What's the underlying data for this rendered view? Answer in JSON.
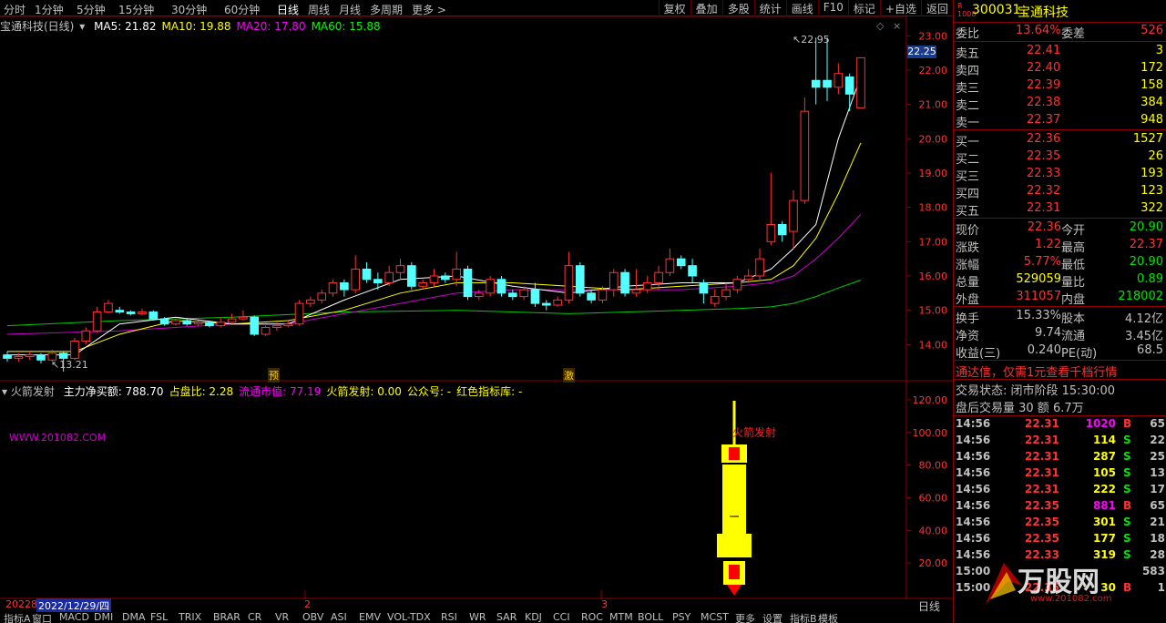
{
  "toolbar": {
    "periods": [
      "分时",
      "1分钟",
      "5分钟",
      "15分钟",
      "30分钟",
      "60分钟",
      "日线",
      "周线",
      "月线",
      "多周期",
      "更多 >"
    ],
    "active": "日线",
    "right_buttons": [
      "复权",
      "叠加",
      "多股",
      "统计",
      "画线",
      "F10",
      "标记",
      "+自选",
      "返回"
    ]
  },
  "main": {
    "title": "宝通科技(日线)",
    "ma": [
      {
        "label": "MA5: 21.82",
        "color": "#ffffff"
      },
      {
        "label": "MA10: 19.88",
        "color": "#ffff00"
      },
      {
        "label": "MA20: 17.80",
        "color": "#ff00ff"
      },
      {
        "label": "MA60: 15.88",
        "color": "#00ff00"
      }
    ],
    "price_label": "22.25",
    "high_label": "22.95",
    "low_label": "13.21",
    "marker1": "预",
    "marker2": "激",
    "y_ticks": [
      "23.00",
      "22.00",
      "21.00",
      "20.00",
      "19.00",
      "18.00",
      "17.00",
      "16.00",
      "15.00",
      "14.00"
    ],
    "collapse_icon": "diamond-icon"
  },
  "sub": {
    "title": "火箭发射",
    "items": [
      {
        "label": "主力净买额: 788.70",
        "color": "#ffffff"
      },
      {
        "label": "占盘比: 2.28",
        "color": "#ffff00"
      },
      {
        "label": "流通市值: 77.19",
        "color": "#ff00ff"
      },
      {
        "label": "火箭发射: 0.00",
        "color": "#ffff00"
      },
      {
        "label": "公众号: -",
        "color": "#ffff00"
      },
      {
        "label": "红色指标库: -",
        "color": "#ffff00"
      }
    ],
    "watermark": "WWW.201082.COM",
    "rocket_label": "火箭发射",
    "y_ticks": [
      "120.00",
      "100.00",
      "80.00",
      "60.00",
      "40.00",
      "20.00"
    ]
  },
  "dates": {
    "d1": "20228",
    "d2": "2022/12/29/四",
    "d3": "2",
    "d4": "3",
    "corner": "日线"
  },
  "bottom_tabs": [
    "指标A",
    "窗口",
    "MACD",
    "DMI",
    "DMA",
    "FSL",
    "TRIX",
    "BRAR",
    "CR",
    "VR",
    "OBV",
    "ASI",
    "EMV",
    "VOL-TDX",
    "RSI",
    "WR",
    "SAR",
    "KDJ",
    "CCI",
    "ROC",
    "MTM",
    "BOLL",
    "PSY",
    "MCST",
    "更多",
    "设置",
    "指标B",
    "模板"
  ],
  "quote": {
    "code": "300031",
    "name": "宝通科技",
    "weibi_label": "委比",
    "weibi": "13.64%",
    "weicha_label": "委差",
    "weicha": "526",
    "asks": [
      {
        "l": "卖五",
        "p": "22.41",
        "v": "3"
      },
      {
        "l": "卖四",
        "p": "22.40",
        "v": "172"
      },
      {
        "l": "卖三",
        "p": "22.39",
        "v": "158"
      },
      {
        "l": "卖二",
        "p": "22.38",
        "v": "384"
      },
      {
        "l": "卖一",
        "p": "22.37",
        "v": "948"
      }
    ],
    "bids": [
      {
        "l": "买一",
        "p": "22.36",
        "v": "1527"
      },
      {
        "l": "买二",
        "p": "22.35",
        "v": "26"
      },
      {
        "l": "买三",
        "p": "22.33",
        "v": "193"
      },
      {
        "l": "买四",
        "p": "22.32",
        "v": "123"
      },
      {
        "l": "买五",
        "p": "22.31",
        "v": "322"
      }
    ],
    "stats": [
      {
        "l1": "现价",
        "v1": "22.36",
        "c1": "#ff3232",
        "l2": "今开",
        "v2": "20.90",
        "c2": "#00e600"
      },
      {
        "l1": "涨跌",
        "v1": "1.22",
        "c1": "#ff3232",
        "l2": "最高",
        "v2": "22.37",
        "c2": "#ff3232"
      },
      {
        "l1": "涨幅",
        "v1": "5.77%",
        "c1": "#ff3232",
        "l2": "最低",
        "v2": "20.90",
        "c2": "#00e600"
      },
      {
        "l1": "总量",
        "v1": "529059",
        "c1": "#ffff00",
        "l2": "量比",
        "v2": "0.89",
        "c2": "#00e600"
      },
      {
        "l1": "外盘",
        "v1": "311057",
        "c1": "#ff3232",
        "l2": "内盘",
        "v2": "218002",
        "c2": "#00e600"
      }
    ],
    "stats2": [
      {
        "l1": "换手",
        "v1": "15.33%",
        "l2": "股本",
        "v2": "4.12亿"
      },
      {
        "l1": "净资",
        "v1": "9.74",
        "l2": "流通",
        "v2": "3.45亿"
      },
      {
        "l1": "收益(三)",
        "v1": "0.240",
        "l2": "PE(动)",
        "v2": "68.5"
      }
    ],
    "ad": "通达信，仅需1元查看千档行情",
    "trade_state": "交易状态: 闭市阶段 15:30:00",
    "after_hours": "盘后交易量 30 额 6.7万",
    "ticks": [
      {
        "t": "14:56",
        "p": "22.31",
        "v": "1020",
        "s": "B",
        "n": "65",
        "vc": "#ff00ff"
      },
      {
        "t": "14:56",
        "p": "22.31",
        "v": "114",
        "s": "S",
        "n": "22",
        "vc": "#ffff00"
      },
      {
        "t": "14:56",
        "p": "22.31",
        "v": "287",
        "s": "S",
        "n": "25",
        "vc": "#ffff00"
      },
      {
        "t": "14:56",
        "p": "22.31",
        "v": "105",
        "s": "S",
        "n": "13",
        "vc": "#ffff00"
      },
      {
        "t": "14:56",
        "p": "22.31",
        "v": "222",
        "s": "S",
        "n": "17",
        "vc": "#ffff00"
      },
      {
        "t": "14:56",
        "p": "22.35",
        "v": "881",
        "s": "B",
        "n": "65",
        "vc": "#ff00ff"
      },
      {
        "t": "14:56",
        "p": "22.35",
        "v": "301",
        "s": "S",
        "n": "21",
        "vc": "#ffff00"
      },
      {
        "t": "14:56",
        "p": "22.35",
        "v": "177",
        "s": "S",
        "n": "18",
        "vc": "#ffff00"
      },
      {
        "t": "14:56",
        "p": "22.33",
        "v": "319",
        "s": "S",
        "n": "28",
        "vc": "#ffff00"
      },
      {
        "t": "15:00",
        "p": "",
        "v": "",
        "s": "",
        "n": "583",
        "vc": "#ffff00"
      },
      {
        "t": "15:00",
        "p": "22.35",
        "v": "30",
        "s": "B",
        "n": "1",
        "vc": "#ffff00"
      }
    ],
    "site_logo": "万股网",
    "site_url": "www.201082.com"
  },
  "chart_data": {
    "type": "candlestick",
    "price_range": [
      13.0,
      23.3
    ],
    "candles": [
      [
        13.7,
        13.6,
        13.8,
        13.5
      ],
      [
        13.6,
        13.65,
        13.75,
        13.5
      ],
      [
        13.65,
        13.7,
        13.8,
        13.55
      ],
      [
        13.7,
        13.55,
        13.75,
        13.45
      ],
      [
        13.55,
        13.75,
        13.85,
        13.5
      ],
      [
        13.75,
        13.6,
        13.8,
        13.21
      ],
      [
        13.6,
        14.1,
        14.2,
        13.55
      ],
      [
        14.1,
        14.4,
        14.5,
        14.0
      ],
      [
        14.4,
        14.95,
        15.1,
        14.35
      ],
      [
        14.95,
        15.2,
        15.3,
        14.9
      ],
      [
        15.0,
        14.95,
        15.1,
        14.9
      ],
      [
        14.95,
        14.9,
        15.0,
        14.85
      ],
      [
        14.9,
        14.95,
        15.05,
        14.85
      ],
      [
        14.95,
        14.75,
        15.0,
        14.7
      ],
      [
        14.75,
        14.6,
        14.8,
        14.55
      ],
      [
        14.6,
        14.7,
        14.75,
        14.55
      ],
      [
        14.7,
        14.6,
        14.75,
        14.55
      ],
      [
        14.6,
        14.65,
        14.7,
        14.55
      ],
      [
        14.65,
        14.55,
        14.7,
        14.5
      ],
      [
        14.55,
        14.65,
        14.8,
        14.5
      ],
      [
        14.65,
        14.75,
        14.9,
        14.6
      ],
      [
        14.75,
        14.8,
        15.0,
        14.7
      ],
      [
        14.8,
        14.3,
        14.85,
        14.25
      ],
      [
        14.3,
        14.5,
        14.55,
        14.25
      ],
      [
        14.5,
        14.55,
        14.65,
        14.4
      ],
      [
        14.55,
        14.6,
        14.7,
        14.5
      ],
      [
        14.6,
        15.2,
        15.3,
        14.55
      ],
      [
        15.2,
        15.3,
        15.4,
        15.1
      ],
      [
        15.3,
        15.5,
        15.6,
        15.2
      ],
      [
        15.5,
        15.8,
        15.9,
        15.4
      ],
      [
        15.8,
        15.6,
        15.9,
        15.4
      ],
      [
        15.6,
        16.2,
        16.6,
        15.5
      ],
      [
        16.2,
        15.9,
        16.4,
        15.8
      ],
      [
        15.9,
        15.8,
        16.1,
        15.6
      ],
      [
        15.8,
        16.1,
        16.3,
        15.7
      ],
      [
        16.1,
        16.3,
        16.5,
        15.9
      ],
      [
        16.3,
        15.7,
        16.4,
        15.6
      ],
      [
        15.7,
        15.8,
        15.9,
        15.6
      ],
      [
        15.8,
        16.0,
        16.2,
        15.7
      ],
      [
        16.0,
        15.9,
        16.1,
        15.8
      ],
      [
        15.9,
        16.2,
        16.7,
        15.7
      ],
      [
        16.2,
        15.4,
        16.3,
        15.3
      ],
      [
        15.4,
        15.5,
        15.6,
        15.3
      ],
      [
        15.5,
        15.9,
        16.0,
        15.4
      ],
      [
        15.9,
        15.5,
        16.0,
        15.4
      ],
      [
        15.5,
        15.4,
        15.6,
        15.3
      ],
      [
        15.4,
        15.6,
        15.7,
        15.3
      ],
      [
        15.6,
        15.2,
        15.8,
        15.1
      ],
      [
        15.2,
        15.15,
        15.3,
        15.0
      ],
      [
        15.15,
        15.3,
        15.4,
        15.1
      ],
      [
        15.3,
        16.3,
        16.7,
        15.2
      ],
      [
        16.3,
        15.5,
        16.4,
        15.4
      ],
      [
        15.5,
        15.3,
        15.6,
        15.2
      ],
      [
        15.3,
        15.6,
        15.7,
        15.2
      ],
      [
        15.6,
        16.1,
        16.2,
        15.4
      ],
      [
        16.1,
        15.5,
        16.2,
        15.4
      ],
      [
        15.5,
        15.6,
        16.2,
        15.4
      ],
      [
        15.6,
        15.8,
        16.0,
        15.5
      ],
      [
        15.8,
        16.1,
        16.3,
        15.6
      ],
      [
        16.1,
        16.5,
        16.8,
        16.0
      ],
      [
        16.5,
        16.3,
        16.6,
        16.2
      ],
      [
        16.3,
        16.0,
        16.5,
        15.8
      ],
      [
        15.8,
        15.5,
        15.9,
        15.2
      ],
      [
        15.2,
        15.4,
        15.6,
        15.1
      ],
      [
        15.4,
        15.6,
        15.8,
        15.3
      ],
      [
        15.6,
        15.9,
        16.0,
        15.5
      ],
      [
        15.9,
        16.0,
        16.2,
        15.8
      ],
      [
        16.0,
        16.5,
        16.8,
        15.9
      ],
      [
        17.0,
        17.5,
        19.0,
        16.9
      ],
      [
        17.5,
        17.2,
        17.6,
        17.0
      ],
      [
        17.3,
        18.2,
        18.5,
        16.8
      ],
      [
        18.2,
        20.8,
        21.2,
        18.1
      ],
      [
        21.7,
        21.5,
        22.95,
        21.0
      ],
      [
        21.7,
        21.5,
        22.95,
        21.1
      ],
      [
        21.5,
        21.9,
        22.2,
        21.3
      ],
      [
        21.8,
        21.3,
        21.9,
        20.8
      ],
      [
        20.9,
        22.36,
        22.37,
        20.9
      ]
    ],
    "ma5": [
      [
        0,
        13.7
      ],
      [
        6,
        13.7
      ],
      [
        10,
        14.6
      ],
      [
        15,
        14.8
      ],
      [
        20,
        14.6
      ],
      [
        25,
        14.6
      ],
      [
        30,
        15.3
      ],
      [
        35,
        15.9
      ],
      [
        40,
        16.0
      ],
      [
        45,
        15.7
      ],
      [
        50,
        15.5
      ],
      [
        55,
        15.7
      ],
      [
        60,
        15.8
      ],
      [
        65,
        15.8
      ],
      [
        68,
        16.2
      ],
      [
        70,
        16.8
      ],
      [
        72,
        17.5
      ],
      [
        74,
        20.0
      ],
      [
        76,
        21.82
      ]
    ],
    "ma10": [
      [
        0,
        13.8
      ],
      [
        6,
        13.8
      ],
      [
        10,
        14.3
      ],
      [
        15,
        14.7
      ],
      [
        20,
        14.6
      ],
      [
        25,
        14.7
      ],
      [
        30,
        15.0
      ],
      [
        35,
        15.5
      ],
      [
        40,
        15.8
      ],
      [
        45,
        15.8
      ],
      [
        50,
        15.7
      ],
      [
        55,
        15.6
      ],
      [
        60,
        15.7
      ],
      [
        65,
        15.8
      ],
      [
        68,
        15.9
      ],
      [
        70,
        16.3
      ],
      [
        72,
        17.1
      ],
      [
        74,
        18.4
      ],
      [
        76,
        19.88
      ]
    ],
    "ma20": [
      [
        0,
        14.3
      ],
      [
        10,
        14.4
      ],
      [
        20,
        14.6
      ],
      [
        25,
        14.6
      ],
      [
        30,
        14.9
      ],
      [
        35,
        15.2
      ],
      [
        40,
        15.5
      ],
      [
        45,
        15.6
      ],
      [
        50,
        15.6
      ],
      [
        55,
        15.6
      ],
      [
        60,
        15.6
      ],
      [
        65,
        15.7
      ],
      [
        68,
        15.8
      ],
      [
        70,
        16.0
      ],
      [
        72,
        16.5
      ],
      [
        74,
        17.1
      ],
      [
        76,
        17.8
      ]
    ],
    "ma60": [
      [
        0,
        14.55
      ],
      [
        10,
        14.7
      ],
      [
        20,
        14.8
      ],
      [
        30,
        14.95
      ],
      [
        40,
        15.0
      ],
      [
        50,
        14.9
      ],
      [
        60,
        15.0
      ],
      [
        65,
        15.05
      ],
      [
        68,
        15.1
      ],
      [
        70,
        15.2
      ],
      [
        72,
        15.4
      ],
      [
        74,
        15.65
      ],
      [
        76,
        15.88
      ]
    ]
  }
}
